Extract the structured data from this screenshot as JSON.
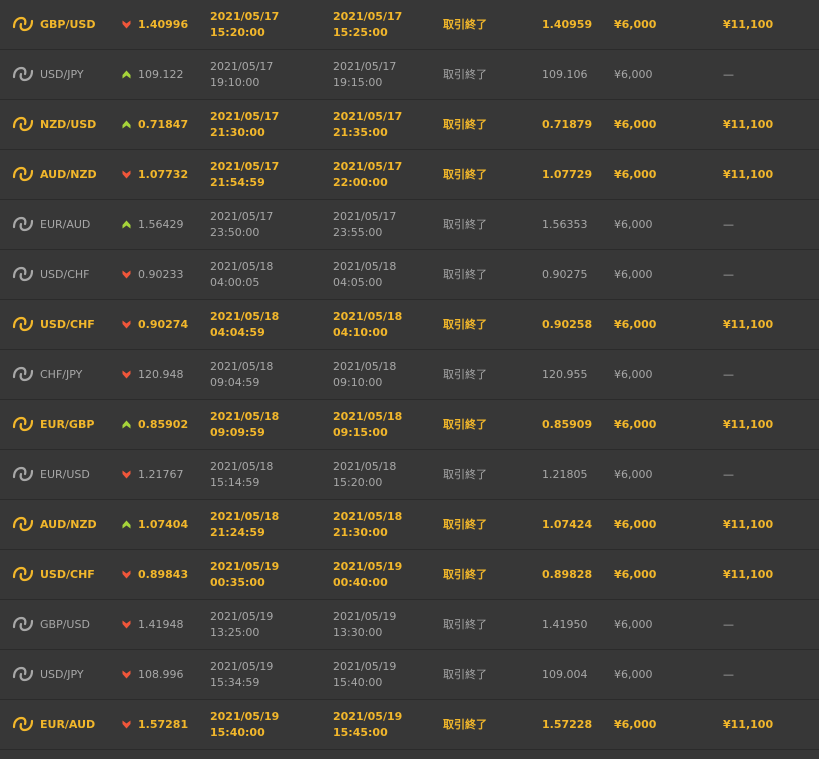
{
  "colors": {
    "background": "#373737",
    "win_text": "#f2b72b",
    "normal_text": "#a7a7a7",
    "up_arrow": "#a6d43a",
    "down_arrow": "#f0563a"
  },
  "rows": [
    {
      "pair": "GBP/USD",
      "direction": "down",
      "entry": "1.40996",
      "start_date": "2021/05/17",
      "start_time": "15:20:00",
      "end_date": "2021/05/17",
      "end_time": "15:25:00",
      "status": "取引終了",
      "close": "1.40959",
      "amount": "¥6,000",
      "payout": "¥11,100",
      "win": true
    },
    {
      "pair": "USD/JPY",
      "direction": "up",
      "entry": "109.122",
      "start_date": "2021/05/17",
      "start_time": "19:10:00",
      "end_date": "2021/05/17",
      "end_time": "19:15:00",
      "status": "取引終了",
      "close": "109.106",
      "amount": "¥6,000",
      "payout": "—",
      "win": false
    },
    {
      "pair": "NZD/USD",
      "direction": "up",
      "entry": "0.71847",
      "start_date": "2021/05/17",
      "start_time": "21:30:00",
      "end_date": "2021/05/17",
      "end_time": "21:35:00",
      "status": "取引終了",
      "close": "0.71879",
      "amount": "¥6,000",
      "payout": "¥11,100",
      "win": true
    },
    {
      "pair": "AUD/NZD",
      "direction": "down",
      "entry": "1.07732",
      "start_date": "2021/05/17",
      "start_time": "21:54:59",
      "end_date": "2021/05/17",
      "end_time": "22:00:00",
      "status": "取引終了",
      "close": "1.07729",
      "amount": "¥6,000",
      "payout": "¥11,100",
      "win": true
    },
    {
      "pair": "EUR/AUD",
      "direction": "up",
      "entry": "1.56429",
      "start_date": "2021/05/17",
      "start_time": "23:50:00",
      "end_date": "2021/05/17",
      "end_time": "23:55:00",
      "status": "取引終了",
      "close": "1.56353",
      "amount": "¥6,000",
      "payout": "—",
      "win": false
    },
    {
      "pair": "USD/CHF",
      "direction": "down",
      "entry": "0.90233",
      "start_date": "2021/05/18",
      "start_time": "04:00:05",
      "end_date": "2021/05/18",
      "end_time": "04:05:00",
      "status": "取引終了",
      "close": "0.90275",
      "amount": "¥6,000",
      "payout": "—",
      "win": false
    },
    {
      "pair": "USD/CHF",
      "direction": "down",
      "entry": "0.90274",
      "start_date": "2021/05/18",
      "start_time": "04:04:59",
      "end_date": "2021/05/18",
      "end_time": "04:10:00",
      "status": "取引終了",
      "close": "0.90258",
      "amount": "¥6,000",
      "payout": "¥11,100",
      "win": true
    },
    {
      "pair": "CHF/JPY",
      "direction": "down",
      "entry": "120.948",
      "start_date": "2021/05/18",
      "start_time": "09:04:59",
      "end_date": "2021/05/18",
      "end_time": "09:10:00",
      "status": "取引終了",
      "close": "120.955",
      "amount": "¥6,000",
      "payout": "—",
      "win": false
    },
    {
      "pair": "EUR/GBP",
      "direction": "up",
      "entry": "0.85902",
      "start_date": "2021/05/18",
      "start_time": "09:09:59",
      "end_date": "2021/05/18",
      "end_time": "09:15:00",
      "status": "取引終了",
      "close": "0.85909",
      "amount": "¥6,000",
      "payout": "¥11,100",
      "win": true
    },
    {
      "pair": "EUR/USD",
      "direction": "down",
      "entry": "1.21767",
      "start_date": "2021/05/18",
      "start_time": "15:14:59",
      "end_date": "2021/05/18",
      "end_time": "15:20:00",
      "status": "取引終了",
      "close": "1.21805",
      "amount": "¥6,000",
      "payout": "—",
      "win": false
    },
    {
      "pair": "AUD/NZD",
      "direction": "up",
      "entry": "1.07404",
      "start_date": "2021/05/18",
      "start_time": "21:24:59",
      "end_date": "2021/05/18",
      "end_time": "21:30:00",
      "status": "取引終了",
      "close": "1.07424",
      "amount": "¥6,000",
      "payout": "¥11,100",
      "win": true
    },
    {
      "pair": "USD/CHF",
      "direction": "down",
      "entry": "0.89843",
      "start_date": "2021/05/19",
      "start_time": "00:35:00",
      "end_date": "2021/05/19",
      "end_time": "00:40:00",
      "status": "取引終了",
      "close": "0.89828",
      "amount": "¥6,000",
      "payout": "¥11,100",
      "win": true
    },
    {
      "pair": "GBP/USD",
      "direction": "down",
      "entry": "1.41948",
      "start_date": "2021/05/19",
      "start_time": "13:25:00",
      "end_date": "2021/05/19",
      "end_time": "13:30:00",
      "status": "取引終了",
      "close": "1.41950",
      "amount": "¥6,000",
      "payout": "—",
      "win": false
    },
    {
      "pair": "USD/JPY",
      "direction": "down",
      "entry": "108.996",
      "start_date": "2021/05/19",
      "start_time": "15:34:59",
      "end_date": "2021/05/19",
      "end_time": "15:40:00",
      "status": "取引終了",
      "close": "109.004",
      "amount": "¥6,000",
      "payout": "—",
      "win": false
    },
    {
      "pair": "EUR/AUD",
      "direction": "down",
      "entry": "1.57281",
      "start_date": "2021/05/19",
      "start_time": "15:40:00",
      "end_date": "2021/05/19",
      "end_time": "15:45:00",
      "status": "取引終了",
      "close": "1.57228",
      "amount": "¥6,000",
      "payout": "¥11,100",
      "win": true
    }
  ]
}
